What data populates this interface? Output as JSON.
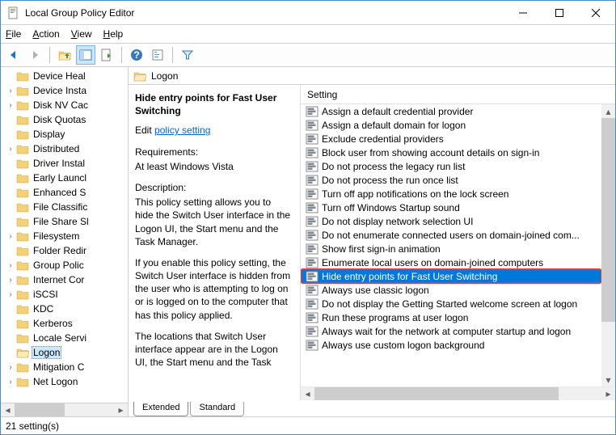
{
  "window": {
    "title": "Local Group Policy Editor"
  },
  "menu": {
    "file": "File",
    "action": "Action",
    "view": "View",
    "help": "Help"
  },
  "tree": {
    "items": [
      {
        "label": "Device Heal",
        "twisty": ""
      },
      {
        "label": "Device Insta",
        "twisty": "›"
      },
      {
        "label": "Disk NV Cac",
        "twisty": "›"
      },
      {
        "label": "Disk Quotas",
        "twisty": ""
      },
      {
        "label": "Display",
        "twisty": ""
      },
      {
        "label": "Distributed",
        "twisty": "›"
      },
      {
        "label": "Driver Instal",
        "twisty": ""
      },
      {
        "label": "Early Launcl",
        "twisty": ""
      },
      {
        "label": "Enhanced S",
        "twisty": ""
      },
      {
        "label": "File Classific",
        "twisty": ""
      },
      {
        "label": "File Share Sl",
        "twisty": ""
      },
      {
        "label": "Filesystem",
        "twisty": "›"
      },
      {
        "label": "Folder Redir",
        "twisty": ""
      },
      {
        "label": "Group Polic",
        "twisty": "›"
      },
      {
        "label": "Internet Cor",
        "twisty": "›"
      },
      {
        "label": "iSCSI",
        "twisty": "›"
      },
      {
        "label": "KDC",
        "twisty": ""
      },
      {
        "label": "Kerberos",
        "twisty": ""
      },
      {
        "label": "Locale Servi",
        "twisty": ""
      },
      {
        "label": "Logon",
        "twisty": "",
        "selected": true
      },
      {
        "label": "Mitigation C",
        "twisty": "›"
      },
      {
        "label": "Net Logon",
        "twisty": "›"
      }
    ]
  },
  "header": {
    "title": "Logon"
  },
  "description": {
    "heading": "Hide entry points for Fast User Switching",
    "edit_prefix": "Edit ",
    "edit_link": "policy setting",
    "requirements_label": "Requirements:",
    "requirements_value": "At least Windows Vista",
    "description_label": "Description:",
    "para1": "This policy setting allows you to hide the Switch User interface in the Logon UI, the Start menu and the Task Manager.",
    "para2": "If you enable this policy setting, the Switch User interface is hidden from the user who is attempting to log on or is logged on to the computer that has this policy applied.",
    "para3": "The locations that Switch User interface appear are in the Logon UI, the Start menu and the Task"
  },
  "settings": {
    "column_header": "Setting",
    "items": [
      "Assign a default credential provider",
      "Assign a default domain for logon",
      "Exclude credential providers",
      "Block user from showing account details on sign-in",
      "Do not process the legacy run list",
      "Do not process the run once list",
      "Turn off app notifications on the lock screen",
      "Turn off Windows Startup sound",
      "Do not display network selection UI",
      "Do not enumerate connected users on domain-joined com...",
      "Show first sign-in animation",
      "Enumerate local users on domain-joined computers",
      "Hide entry points for Fast User Switching",
      "Always use classic logon",
      "Do not display the Getting Started welcome screen at logon",
      "Run these programs at user logon",
      "Always wait for the network at computer startup and logon",
      "Always use custom logon background"
    ],
    "selected_index": 12
  },
  "tabs": {
    "extended": "Extended",
    "standard": "Standard"
  },
  "status": {
    "text": "21 setting(s)"
  }
}
